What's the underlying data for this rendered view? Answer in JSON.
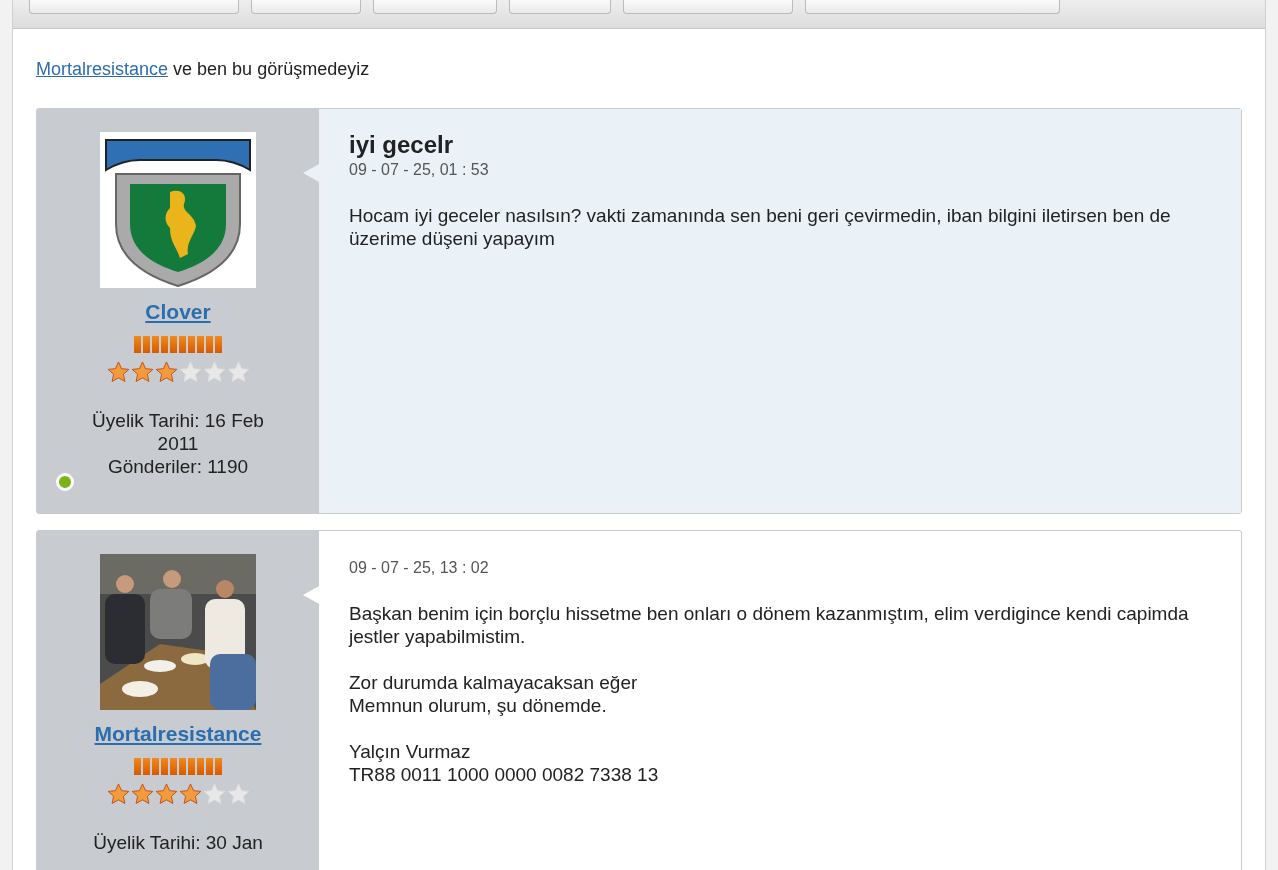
{
  "toolbar": {
    "buttons": [
      {
        "kind": "plain"
      },
      {
        "kind": "plain"
      },
      {
        "kind": "plain"
      },
      {
        "kind": "plain"
      },
      {
        "kind": "plain"
      },
      {
        "kind": "plain"
      }
    ]
  },
  "participants": {
    "link": "Mortalresistance",
    "text": "ve ben bu görüşmedeyiz"
  },
  "posts": [
    {
      "highlighted": true,
      "avatar": {
        "kind": "logo"
      },
      "username": "Clover",
      "stars": 3,
      "joined": "Üyelik Tarihi: 16 Feb 2011",
      "posts_count": "Gönderiler: 1190",
      "online": true,
      "title": "iyi gecelr",
      "date": "09 - 07 - 25, 01 : 53",
      "body": [
        "Hocam iyi geceler nasılsın? vakti zamanında sen beni geri çevirmedin, iban bilgini iletirsen ben de üzerime düşeni yapayım"
      ]
    },
    {
      "highlighted": false,
      "username": "Mortalresistance",
      "stars": 4,
      "joined": "Üyelik Tarihi: 30 Jan",
      "date": "09 - 07 - 25, 13 : 02",
      "body": [
        "Başkan benim için borçlu hissetme ben onları o dönem kazanmıştım, elim verdigince kendi capimda jestler yapabilmistim.",
        "Zor durumda kalmayacaksan eğer\nMemnun olurum, şu dönemde.",
        "Yalçın Vurmaz\nTR88 0011 1000 0000 0082 7338 13"
      ]
    }
  ]
}
